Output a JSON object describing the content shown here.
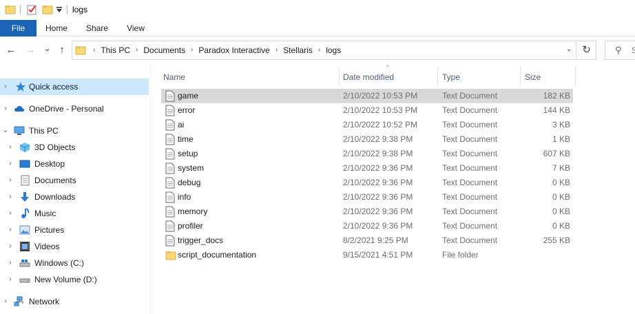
{
  "window": {
    "title": "logs"
  },
  "quick_access_toolbar": {
    "icons": [
      "folder-icon",
      "properties-icon",
      "new-folder-icon",
      "customize-dropdown-icon"
    ]
  },
  "ribbon": {
    "tabs": [
      "File",
      "Home",
      "Share",
      "View"
    ]
  },
  "nav": {
    "back": "←",
    "forward": "→",
    "recent": "⌄",
    "up": "↑",
    "refresh": "↻",
    "dropdown": "⌄"
  },
  "address": {
    "crumbs": [
      "This PC",
      "Documents",
      "Paradox Interactive",
      "Stellaris",
      "logs"
    ],
    "separator": "›"
  },
  "search": {
    "icon": "⚲",
    "text": "S"
  },
  "sidebar": {
    "items": [
      {
        "label": "Quick access",
        "icon": "star-icon",
        "expand": "›"
      },
      {
        "label": "OneDrive - Personal",
        "icon": "cloud-icon",
        "expand": "›"
      },
      {
        "label": "This PC",
        "icon": "pc-icon",
        "expand": "⌄"
      },
      {
        "label": "3D Objects",
        "icon": "cube-icon",
        "expand": "›"
      },
      {
        "label": "Desktop",
        "icon": "desktop-icon",
        "expand": "›"
      },
      {
        "label": "Documents",
        "icon": "documents-icon",
        "expand": "›"
      },
      {
        "label": "Downloads",
        "icon": "download-icon",
        "expand": "›"
      },
      {
        "label": "Music",
        "icon": "music-icon",
        "expand": "›"
      },
      {
        "label": "Pictures",
        "icon": "pictures-icon",
        "expand": "›"
      },
      {
        "label": "Videos",
        "icon": "videos-icon",
        "expand": "›"
      },
      {
        "label": "Windows (C:)",
        "icon": "drive-icon",
        "expand": "›"
      },
      {
        "label": "New Volume (D:)",
        "icon": "drive-icon",
        "expand": "›"
      },
      {
        "label": "Network",
        "icon": "network-icon",
        "expand": "›"
      }
    ]
  },
  "columns": {
    "name": "Name",
    "date": "Date modified",
    "type": "Type",
    "size": "Size",
    "sort_caret": "^"
  },
  "files": [
    {
      "name": "game",
      "date": "2/10/2022 10:53 PM",
      "type": "Text Document",
      "size": "182 KB",
      "kind": "text"
    },
    {
      "name": "error",
      "date": "2/10/2022 10:53 PM",
      "type": "Text Document",
      "size": "144 KB",
      "kind": "text"
    },
    {
      "name": "ai",
      "date": "2/10/2022 10:52 PM",
      "type": "Text Document",
      "size": "3 KB",
      "kind": "text"
    },
    {
      "name": "time",
      "date": "2/10/2022 9:38 PM",
      "type": "Text Document",
      "size": "1 KB",
      "kind": "text"
    },
    {
      "name": "setup",
      "date": "2/10/2022 9:38 PM",
      "type": "Text Document",
      "size": "607 KB",
      "kind": "text"
    },
    {
      "name": "system",
      "date": "2/10/2022 9:36 PM",
      "type": "Text Document",
      "size": "7 KB",
      "kind": "text"
    },
    {
      "name": "debug",
      "date": "2/10/2022 9:36 PM",
      "type": "Text Document",
      "size": "0 KB",
      "kind": "text"
    },
    {
      "name": "info",
      "date": "2/10/2022 9:36 PM",
      "type": "Text Document",
      "size": "0 KB",
      "kind": "text"
    },
    {
      "name": "memory",
      "date": "2/10/2022 9:36 PM",
      "type": "Text Document",
      "size": "0 KB",
      "kind": "text"
    },
    {
      "name": "profiler",
      "date": "2/10/2022 9:36 PM",
      "type": "Text Document",
      "size": "0 KB",
      "kind": "text"
    },
    {
      "name": "trigger_docs",
      "date": "8/2/2021 9:25 PM",
      "type": "Text Document",
      "size": "255 KB",
      "kind": "text"
    },
    {
      "name": "script_documentation",
      "date": "9/15/2021 4:51 PM",
      "type": "File folder",
      "size": "",
      "kind": "folder"
    }
  ],
  "colors": {
    "file_tab": "#1b63b5",
    "sidebar_selected": "#cce8ff",
    "row_selected": "#d9d9d9",
    "header_text": "#4c607a",
    "folder": "#f8d775"
  }
}
